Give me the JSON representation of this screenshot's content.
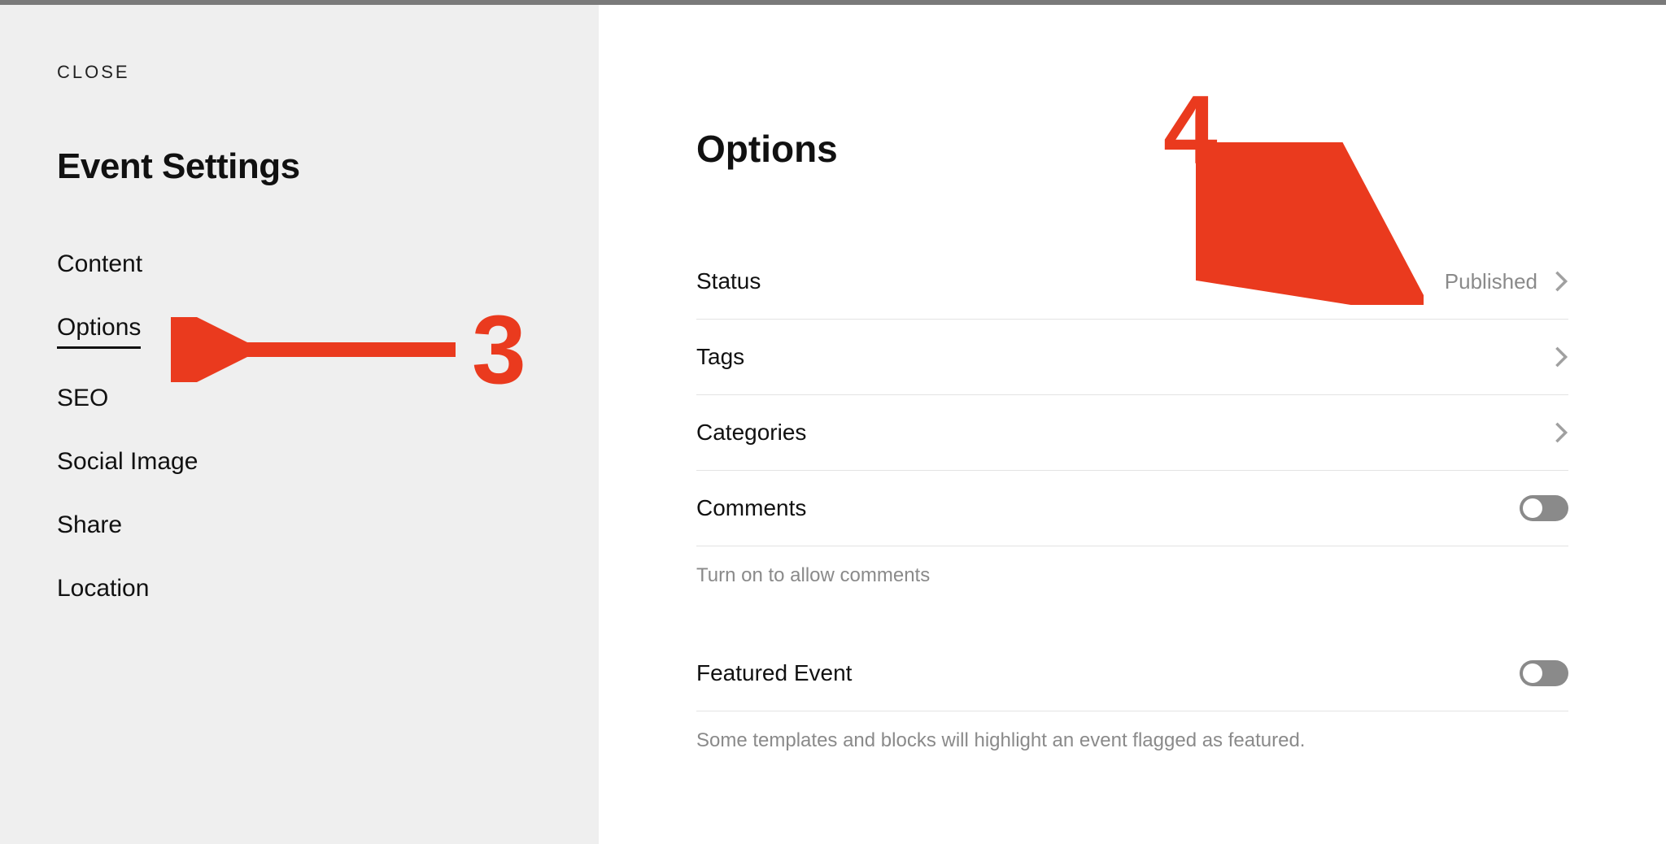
{
  "sidebar": {
    "close": "CLOSE",
    "title": "Event Settings",
    "nav": [
      {
        "label": "Content",
        "active": false
      },
      {
        "label": "Options",
        "active": true
      },
      {
        "label": "SEO",
        "active": false
      },
      {
        "label": "Social Image",
        "active": false
      },
      {
        "label": "Share",
        "active": false
      },
      {
        "label": "Location",
        "active": false
      }
    ]
  },
  "main": {
    "title": "Options",
    "rows": {
      "status": {
        "label": "Status",
        "value": "Published"
      },
      "tags": {
        "label": "Tags"
      },
      "categories": {
        "label": "Categories"
      },
      "comments": {
        "label": "Comments",
        "help": "Turn on to allow comments",
        "on": false
      },
      "featured": {
        "label": "Featured Event",
        "help": "Some templates and blocks will highlight an event flagged as featured.",
        "on": false
      }
    }
  },
  "annotations": {
    "num3": "3",
    "num4": "4",
    "color": "#ea3a1e"
  }
}
